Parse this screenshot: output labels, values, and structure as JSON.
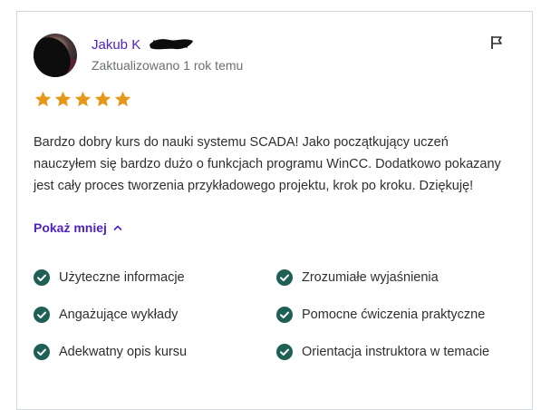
{
  "review": {
    "author_visible": "Jakub K",
    "subtitle": "Zaktualizowano 1 rok temu",
    "rating": 5,
    "text": "Bardzo dobry kurs do nauki systemu SCADA! Jako początkujący uczeń nauczyłem się bardzo dużo o funkcjach programu WinCC. Dodatkowo pokazany jest cały proces tworzenia przykładowego projektu, krok po kroku. Dziękuję!",
    "toggle_label": "Pokaż mniej",
    "feedback_tags": [
      "Użyteczne informacje",
      "Zrozumiałe wyjaśnienia",
      "Angażujące wykłady",
      "Pomocne ćwiczenia praktyczne",
      "Adekwatny opis kursu",
      "Orientacja instruktora w temacie"
    ]
  },
  "icons": {
    "report": "flag-icon",
    "rating": "star-icon",
    "toggle": "chevron-up-icon",
    "tag": "check-circle-icon"
  },
  "colors": {
    "accent": "#5022c3",
    "star": "#e59819",
    "check": "#1e6055",
    "muted": "#6a6f73",
    "border": "#d1d7dc"
  }
}
